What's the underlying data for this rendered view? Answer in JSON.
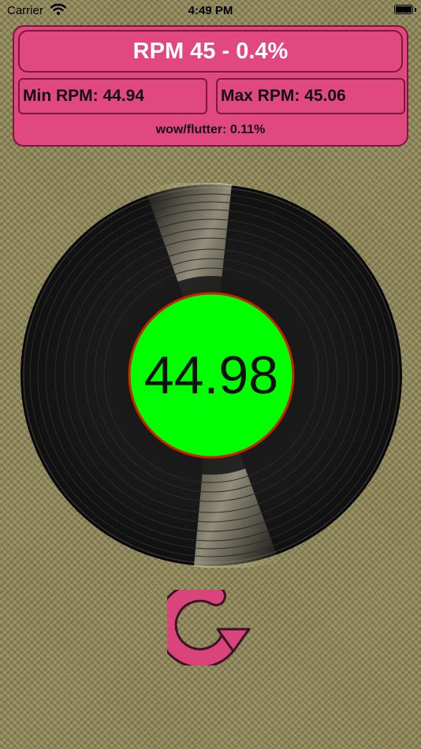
{
  "status_bar": {
    "carrier": "Carrier",
    "time": "4:49 PM"
  },
  "header": {
    "title": "RPM 45 - 0.4%"
  },
  "stats": {
    "min": "Min RPM: 44.94",
    "max": "Max RPM: 45.06",
    "flutter": "wow/flutter: 0.11%"
  },
  "readout": {
    "value": "44.98"
  },
  "icons": {
    "wifi": "wifi-icon",
    "battery": "battery-icon",
    "refresh": "refresh-icon"
  },
  "colors": {
    "panel": "#e1487f",
    "label_green": "#00ff00",
    "label_ring": "#cc2200",
    "refresh": "#d9457a"
  }
}
